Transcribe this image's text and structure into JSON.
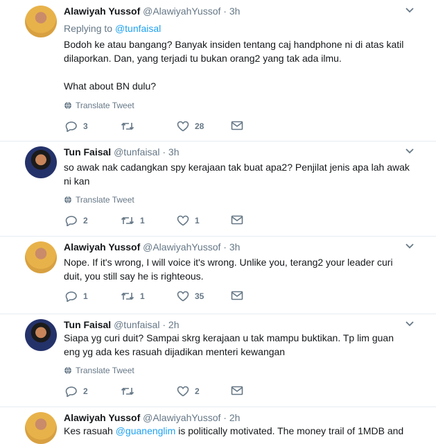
{
  "tweets": [
    {
      "name": "Alawiyah Yussof",
      "handle": "@AlawiyahYussof",
      "dot": "·",
      "time": "3h",
      "replying_prefix": "Replying to",
      "replying_to": "@tunfaisal",
      "line1": "Bodoh ke atau bangang? Banyak insiden tentang caj handphone ni di atas katil",
      "line2": "dilaporkan. Dan, yang terjadi tu bukan orang2 yang tak ada ilmu.",
      "line3": "What about BN dulu?",
      "translate": "Translate Tweet",
      "replies": "3",
      "retweets": "",
      "likes": "28"
    },
    {
      "name": "Tun Faisal",
      "handle": "@tunfaisal",
      "dot": "·",
      "time": "3h",
      "line1": "so awak nak cadangkan spy kerajaan tak buat apa2? Penjilat jenis apa lah awak",
      "line2": "ni kan",
      "translate": "Translate Tweet",
      "replies": "2",
      "retweets": "1",
      "likes": "1"
    },
    {
      "name": "Alawiyah Yussof",
      "handle": "@AlawiyahYussof",
      "dot": "·",
      "time": "3h",
      "line1": "Nope. If it's wrong, I will voice it's wrong. Unlike you, terang2 your leader curi",
      "line2": "duit, you still say he is righteous.",
      "replies": "1",
      "retweets": "1",
      "likes": "35"
    },
    {
      "name": "Tun Faisal",
      "handle": "@tunfaisal",
      "dot": "·",
      "time": "2h",
      "line1": "Siapa yg curi duit? Sampai skrg kerajaan u tak mampu buktikan. Tp lim guan",
      "line2": "eng yg ada kes rasuah dijadikan menteri kewangan",
      "translate": "Translate Tweet",
      "replies": "2",
      "retweets": "",
      "likes": "2"
    },
    {
      "name": "Alawiyah Yussof",
      "handle": "@AlawiyahYussof",
      "dot": "·",
      "time": "2h",
      "line1_a": "Kes rasuah ",
      "line1_mention": "@guanenglim",
      "line1_b": " is politically motivated. The money trail of 1MDB  and"
    }
  ],
  "colors": {
    "link": "#1da1f2",
    "muted": "#657786",
    "text": "#14171a",
    "divider": "#e6ecf0"
  },
  "icons": [
    "globe-icon",
    "reply-icon",
    "retweet-icon",
    "like-icon",
    "message-icon",
    "chevron-down-icon"
  ]
}
